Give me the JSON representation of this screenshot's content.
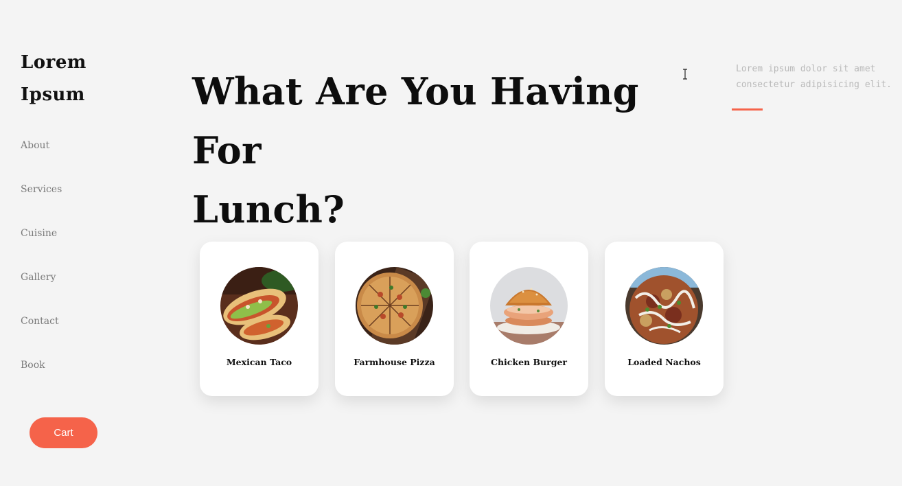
{
  "brand": {
    "line1": "Lorem",
    "line2": "Ipsum"
  },
  "nav": {
    "items": [
      "About",
      "Services",
      "Cuisine",
      "Gallery",
      "Contact",
      "Book"
    ]
  },
  "cart": {
    "label": "Cart"
  },
  "hero": {
    "title_line1": "What Are You Having For",
    "title_line2": "Lunch?"
  },
  "blurb": {
    "line1": "Lorem ipsum dolor sit amet",
    "line2": "consectetur adipisicing elit."
  },
  "menu": {
    "cards": [
      {
        "name": "Mexican Taco",
        "image": "taco-photo"
      },
      {
        "name": "Farmhouse Pizza",
        "image": "pizza-photo"
      },
      {
        "name": "Chicken Burger",
        "image": "burger-photo"
      },
      {
        "name": "Loaded Nachos",
        "image": "nachos-photo"
      }
    ]
  },
  "colors": {
    "accent": "#f5634a",
    "background": "#f4f4f4",
    "text": "#111111",
    "muted": "#7a7a7a"
  }
}
